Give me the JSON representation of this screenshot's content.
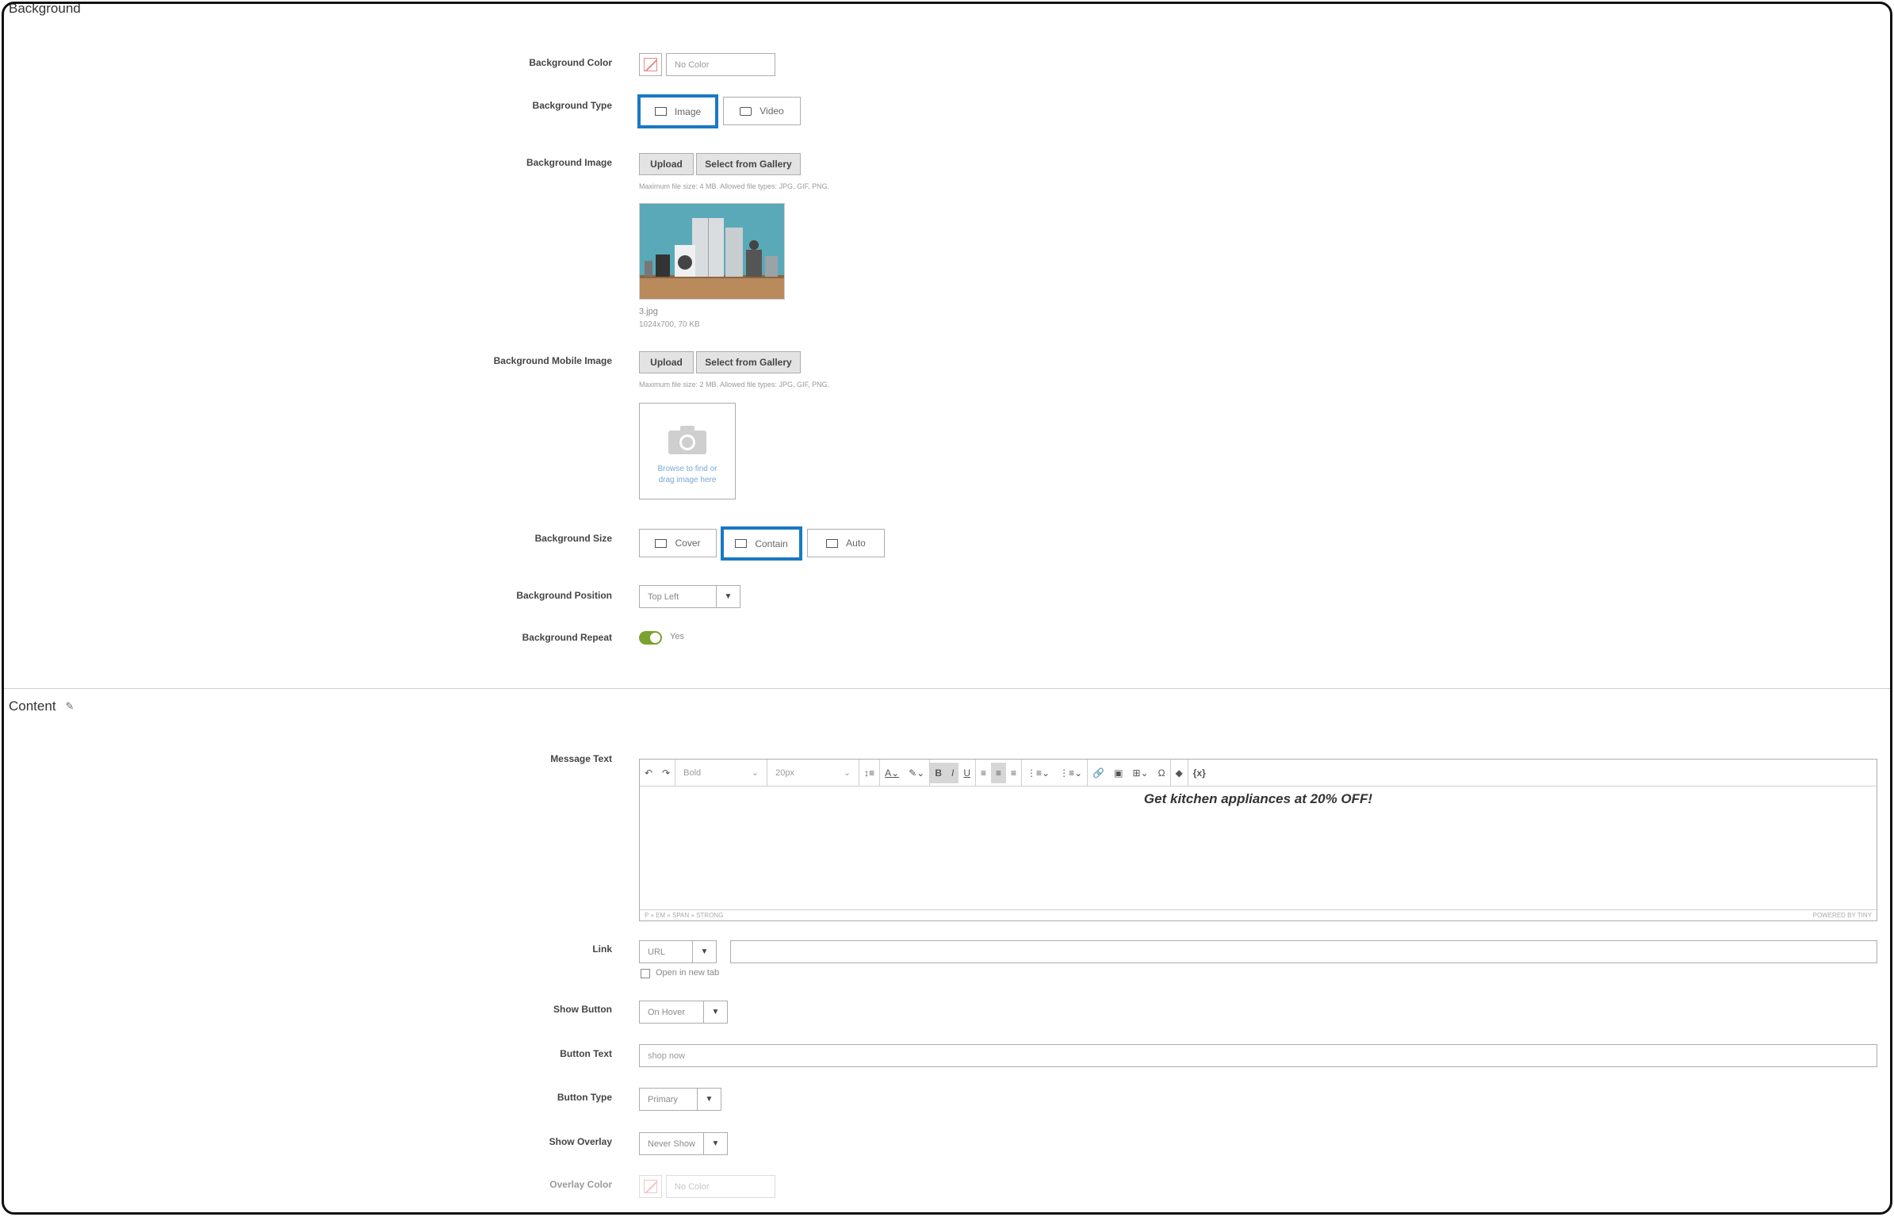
{
  "background": {
    "section_title": "Background",
    "color": {
      "label": "Background Color",
      "value": "No Color"
    },
    "type": {
      "label": "Background Type",
      "options": [
        "Image",
        "Video"
      ],
      "selected": "Image"
    },
    "image": {
      "label": "Background Image",
      "upload_label": "Upload",
      "gallery_label": "Select from Gallery",
      "note": "Maximum file size: 4 MB. Allowed file types: JPG, GIF, PNG.",
      "file_name": "3.jpg",
      "file_meta": "1024x700, 70 KB"
    },
    "mobile_image": {
      "label": "Background Mobile Image",
      "upload_label": "Upload",
      "gallery_label": "Select from Gallery",
      "note": "Maximum file size: 2 MB. Allowed file types: JPG, GIF, PNG.",
      "dropzone_text": "Browse to find or drag image here"
    },
    "size": {
      "label": "Background Size",
      "options": [
        "Cover",
        "Contain",
        "Auto"
      ],
      "selected": "Contain"
    },
    "position": {
      "label": "Background Position",
      "value": "Top Left"
    },
    "repeat": {
      "label": "Background Repeat",
      "value": "Yes"
    }
  },
  "content": {
    "section_title": "Content",
    "message": {
      "label": "Message Text",
      "format_value": "Bold",
      "font_size_value": "20px",
      "text": "Get kitchen appliances at 20% OFF!",
      "statusbar_path": "P » EM » SPAN » STRONG",
      "powered_by": "POWERED BY TINY"
    },
    "link": {
      "label": "Link",
      "type_value": "URL",
      "url_value": "",
      "new_tab_label": "Open in new tab"
    },
    "show_button": {
      "label": "Show Button",
      "value": "On Hover"
    },
    "button_text": {
      "label": "Button Text",
      "value": "shop now"
    },
    "button_type": {
      "label": "Button Type",
      "value": "Primary"
    },
    "show_overlay": {
      "label": "Show Overlay",
      "value": "Never Show"
    },
    "overlay_color": {
      "label": "Overlay Color",
      "value": "No Color"
    }
  },
  "colors": {
    "accent": "#1979c3",
    "toggle_on": "#79a22e",
    "border": "#adadad"
  }
}
